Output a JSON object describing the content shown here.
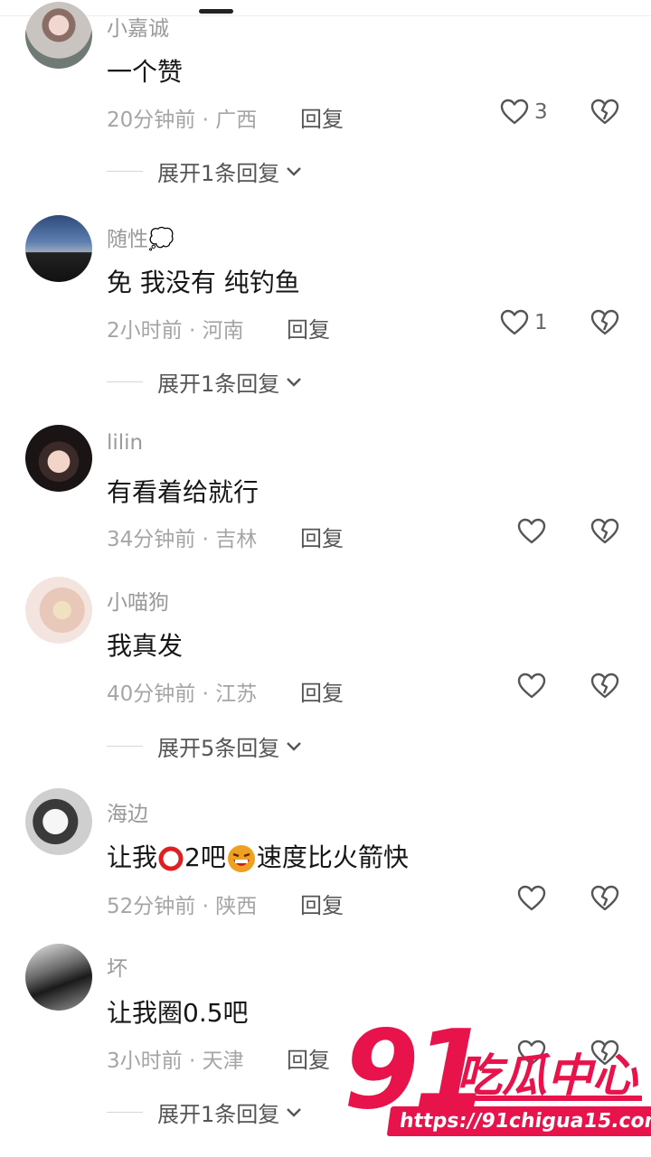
{
  "comments": [
    {
      "username": "小嘉诚",
      "content": "一个赞",
      "meta": "20分钟前 · 广西",
      "reply": "回复",
      "likes": "3",
      "expand": "展开1条回复"
    },
    {
      "username": "随性💭",
      "content": "免 我没有 纯钓鱼",
      "meta": "2小时前 · 河南",
      "reply": "回复",
      "likes": "1",
      "expand": "展开1条回复"
    },
    {
      "username": "lilin",
      "content": "有看着给就行",
      "meta": "34分钟前 · 吉林",
      "reply": "回复",
      "likes": ""
    },
    {
      "username": "小喵狗",
      "content": "我真发",
      "meta": "40分钟前 · 江苏",
      "reply": "回复",
      "likes": "",
      "expand": "展开5条回复"
    },
    {
      "username": "海边",
      "content_a": "让我",
      "content_b": "2吧",
      "content_c": "速度比火箭快",
      "meta": "52分钟前 · 陕西",
      "reply": "回复",
      "likes": ""
    },
    {
      "username": "坏",
      "content": "让我圈0.5吧",
      "meta": "3小时前 · 天津",
      "reply": "回复",
      "likes": "",
      "expand": "展开1条回复"
    }
  ],
  "watermark": {
    "number": "91",
    "brand": "吃瓜中心",
    "url": "https://91chigua15.com"
  },
  "colors": {
    "accent": "#e8134a",
    "text": "#161616",
    "meta": "#a5a5a5"
  }
}
